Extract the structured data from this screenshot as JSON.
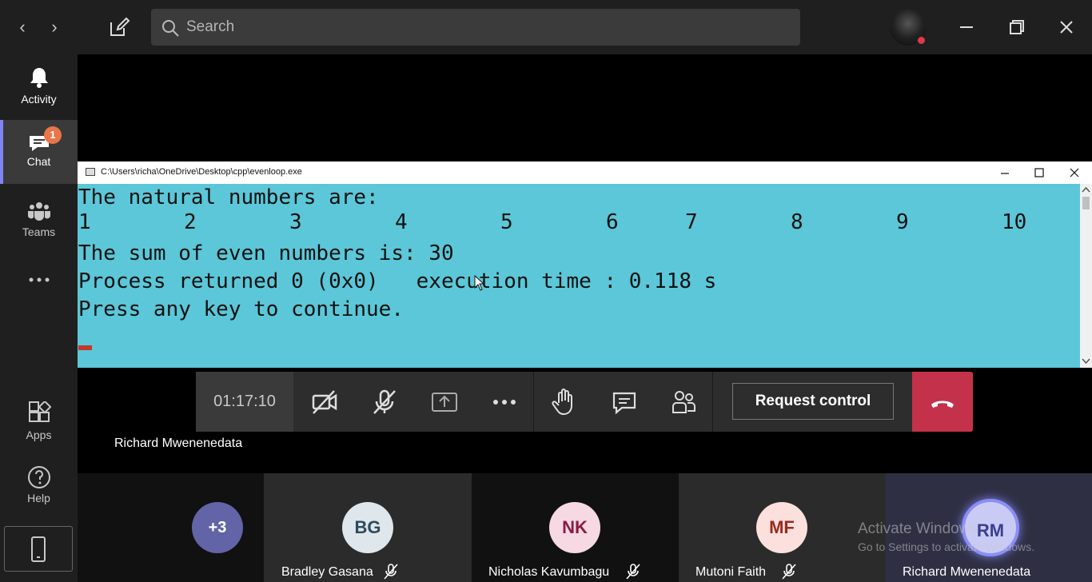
{
  "search": {
    "placeholder": "Search"
  },
  "rail": {
    "items": [
      {
        "label": "Activity"
      },
      {
        "label": "Chat",
        "badge": "1"
      },
      {
        "label": "Teams"
      },
      {
        "label": "Apps"
      },
      {
        "label": "Help"
      }
    ]
  },
  "console": {
    "path": "C:\\Users\\richa\\OneDrive\\Desktop\\cpp\\evenloop.exe",
    "line1": "The natural numbers are:",
    "numbers": [
      "1",
      "2",
      "3",
      "4",
      "5",
      "6",
      "7",
      "8",
      "9",
      "10"
    ],
    "line3": "The sum of even numbers is: 30",
    "line4": "Process returned 0 (0x0)   execution time : 0.118 s",
    "line5": "Press any key to continue."
  },
  "call": {
    "timer": "01:17:10",
    "request_control": "Request control",
    "presenter": "Richard Mwenenedata"
  },
  "participants": {
    "overflow": "+3",
    "list": [
      {
        "initials": "BG",
        "name": "Bradley Gasana",
        "bg": "#dfe7ec",
        "fg": "#2d4a5c"
      },
      {
        "initials": "NK",
        "name": "Nicholas Kavumbagu",
        "bg": "#f7d9e3",
        "fg": "#8a1c44"
      },
      {
        "initials": "MF",
        "name": "Mutoni Faith",
        "bg": "#fbe0dd",
        "fg": "#9b2a1c"
      },
      {
        "initials": "RM",
        "name": "Richard Mwenenedata",
        "bg": "#c9cbf5",
        "fg": "#3b3f8f"
      }
    ]
  },
  "watermark": {
    "line1": "Activate Windows",
    "line2": "Go to Settings to activate Windows."
  },
  "colors": {
    "accent": "#7f85f5",
    "hangup": "#c4314b",
    "console_bg": "#5bc7d8",
    "badge": "#e97548"
  }
}
